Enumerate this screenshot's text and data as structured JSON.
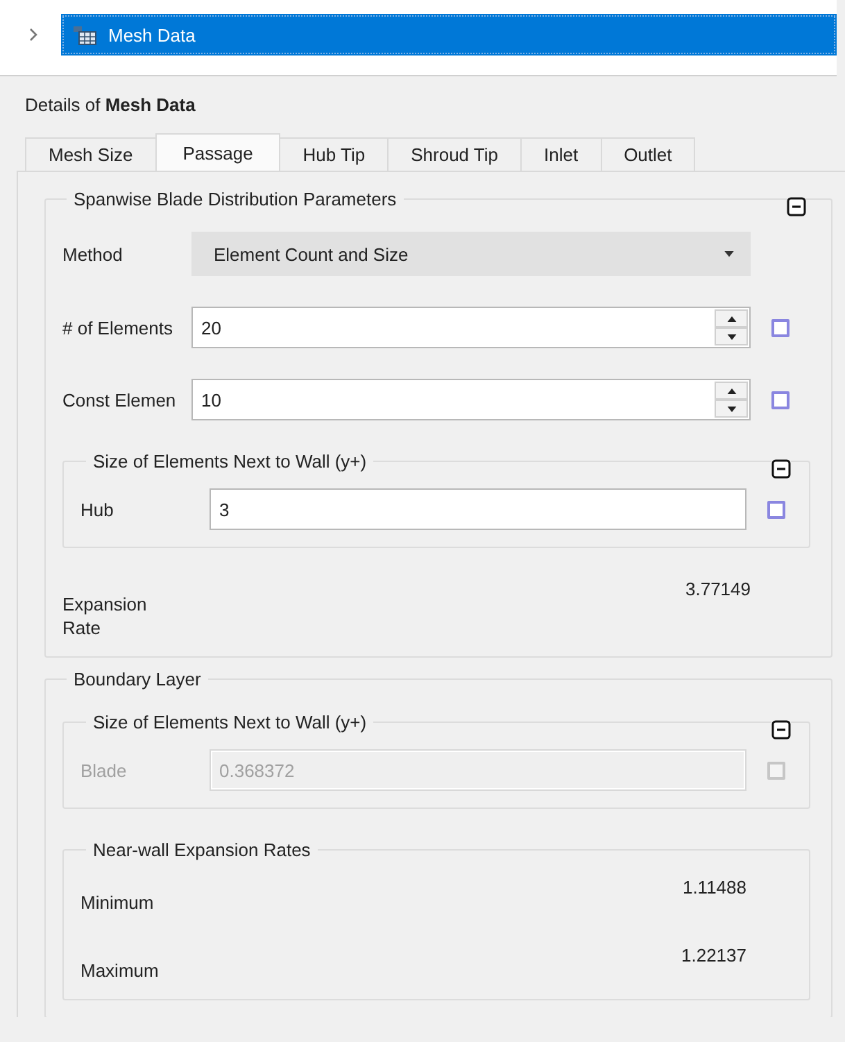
{
  "tree": [
    {
      "label": "Mesh Data",
      "selected": true,
      "expanded": false
    }
  ],
  "details_title": "Details of **Mesh Data**",
  "tabs": [
    {
      "label": "Mesh Size",
      "selected": false
    },
    {
      "label": "Passage",
      "selected": true
    },
    {
      "label": "Hub Tip",
      "selected": false
    },
    {
      "label": "Shroud Tip",
      "selected": false
    },
    {
      "label": "Inlet",
      "selected": false
    },
    {
      "label": "Outlet",
      "selected": false
    }
  ],
  "groups": [
    {
      "title": "Spanwise Blade Distribution Parameters",
      "expanded": true,
      "items": [
        {
          "kind": "combo",
          "label": "Method",
          "value": "Element Count and Size"
        },
        {
          "kind": "spin",
          "label": "# of Elements",
          "value": "20",
          "checked": false
        },
        {
          "kind": "spin",
          "label": "Const Elemen",
          "value": "10",
          "checked": false
        },
        {
          "kind": "group",
          "title": "Size of Elements Next to Wall (y+)",
          "expanded": true,
          "items": [
            {
              "kind": "text",
              "label": "Hub",
              "value": "3",
              "checked": false,
              "disabled": false
            }
          ]
        },
        {
          "kind": "readout",
          "label": "Expansion Rate",
          "value": "3.77149"
        }
      ]
    },
    {
      "title": "Boundary Layer",
      "items": [
        {
          "kind": "group",
          "title": "Size of Elements Next to Wall (y+)",
          "expanded": true,
          "items": [
            {
              "kind": "text",
              "label": "Blade",
              "value": "0.368372",
              "checked": false,
              "disabled": true
            }
          ]
        },
        {
          "kind": "group",
          "title": "Near-wall Expansion Rates",
          "items": [
            {
              "kind": "readout",
              "label": "Minimum",
              "value": "1.11488"
            },
            {
              "kind": "readout",
              "label": "Maximum",
              "value": "1.22137"
            }
          ]
        }
      ]
    }
  ]
}
